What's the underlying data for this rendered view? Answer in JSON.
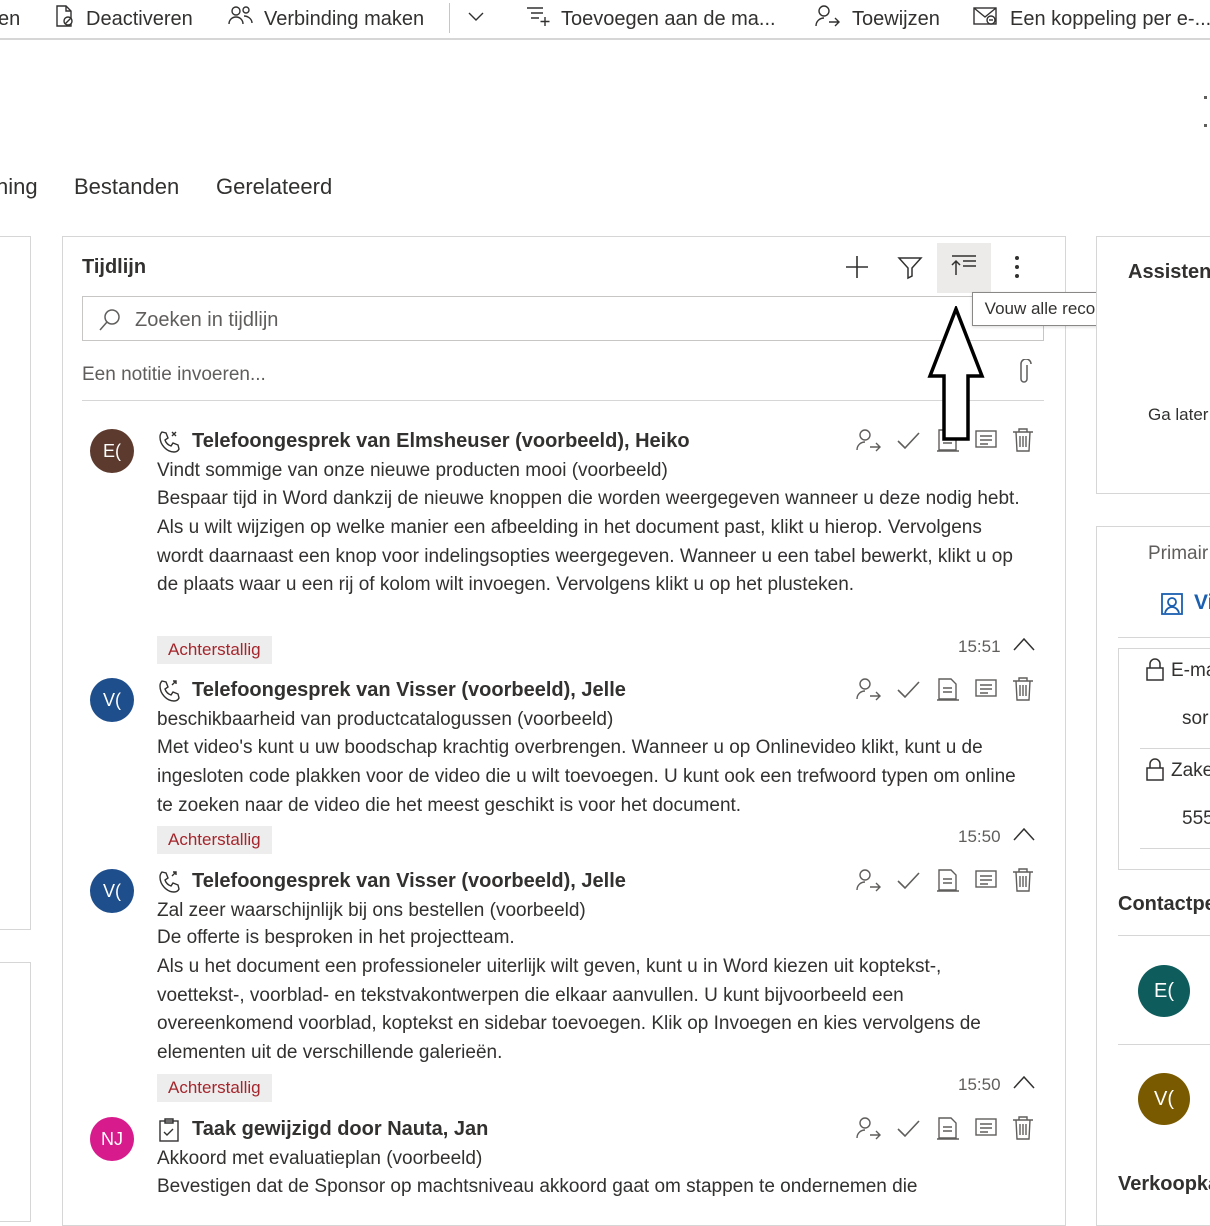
{
  "toolbar": {
    "partial_first": "en",
    "deactivate": "Deactiveren",
    "connect": "Verbinding maken",
    "add_to_list": "Toevoegen aan de ma...",
    "assign": "Toewijzen",
    "email_link": "Een koppeling per e-..."
  },
  "tabs": {
    "partial": "ning",
    "files": "Bestanden",
    "related": "Gerelateerd"
  },
  "timeline": {
    "title": "Tijdlijn",
    "search_placeholder": "Zoeken in tijdlijn",
    "note_placeholder": "Een notitie invoeren...",
    "tooltip": "Vouw alle records samen."
  },
  "records": [
    {
      "initials": "E(",
      "avatar_color": "#5c3a2e",
      "title": "Telefoongesprek van Elmsheuser (voorbeeld), Heiko",
      "subtitle": "Vindt sommige van onze nieuwe producten mooi (voorbeeld)",
      "body": [
        "Bespaar tijd in Word dankzij de nieuwe knoppen die worden weergegeven wanneer u deze nodig hebt. Als u wilt wijzigen op welke manier een afbeelding in het document past, klikt u hierop. Vervolgens wordt daarnaast een knop voor indelingsopties weergegeven. Wanneer u een tabel bewerkt, klikt u op de plaats waar u een rij of kolom wilt invoegen. Vervolgens klikt u op het plusteken."
      ],
      "badge": "Achterstallig",
      "time": "15:51"
    },
    {
      "initials": "V(",
      "avatar_color": "#1e4e8c",
      "title": "Telefoongesprek van Visser (voorbeeld), Jelle",
      "subtitle": "beschikbaarheid van productcatalogussen (voorbeeld)",
      "body": [
        "Met video's kunt u uw boodschap krachtig overbrengen. Wanneer u op Onlinevideo klikt, kunt u de ingesloten code plakken voor de video die u wilt toevoegen. U kunt ook een trefwoord typen om online te zoeken naar de video die het meest geschikt is voor het document."
      ],
      "badge": "Achterstallig",
      "time": "15:50"
    },
    {
      "initials": "V(",
      "avatar_color": "#1e4e8c",
      "title": "Telefoongesprek van Visser (voorbeeld), Jelle",
      "subtitle": "Zal zeer waarschijnlijk bij ons bestellen (voorbeeld)",
      "body": [
        "De offerte is besproken in het projectteam.",
        "Als u het document een professioneler uiterlijk wilt geven, kunt u in Word kiezen uit koptekst-, voettekst-, voorblad- en tekstvakontwerpen die elkaar aanvullen. U kunt bijvoorbeeld een overeenkomend voorblad, koptekst en sidebar toevoegen. Klik op Invoegen en kies vervolgens de elementen uit de verschillende galerieën."
      ],
      "badge": "Achterstallig",
      "time": "15:50"
    },
    {
      "initials": "NJ",
      "avatar_color": "#d81b8c",
      "title": "Taak gewijzigd door Nauta, Jan",
      "subtitle": "Akkoord met evaluatieplan (voorbeeld)",
      "body": [
        "Bevestigen dat de Sponsor op machtsniveau akkoord gaat om stappen te ondernemen die"
      ]
    }
  ],
  "right_panel": {
    "assistant": "Assistent",
    "later": "Ga later",
    "primary": "Primair",
    "primary_link": "Vi",
    "email_label": "E-ma",
    "email_value": "sor",
    "business_label": "Zake",
    "business_value": "555",
    "contacts": "Contactpe",
    "contact1_initials": "E(",
    "contact1_color": "#0f5c5c",
    "contact2_initials": "V(",
    "contact2_color": "#7a5a00",
    "sales": "Verkoopka"
  }
}
